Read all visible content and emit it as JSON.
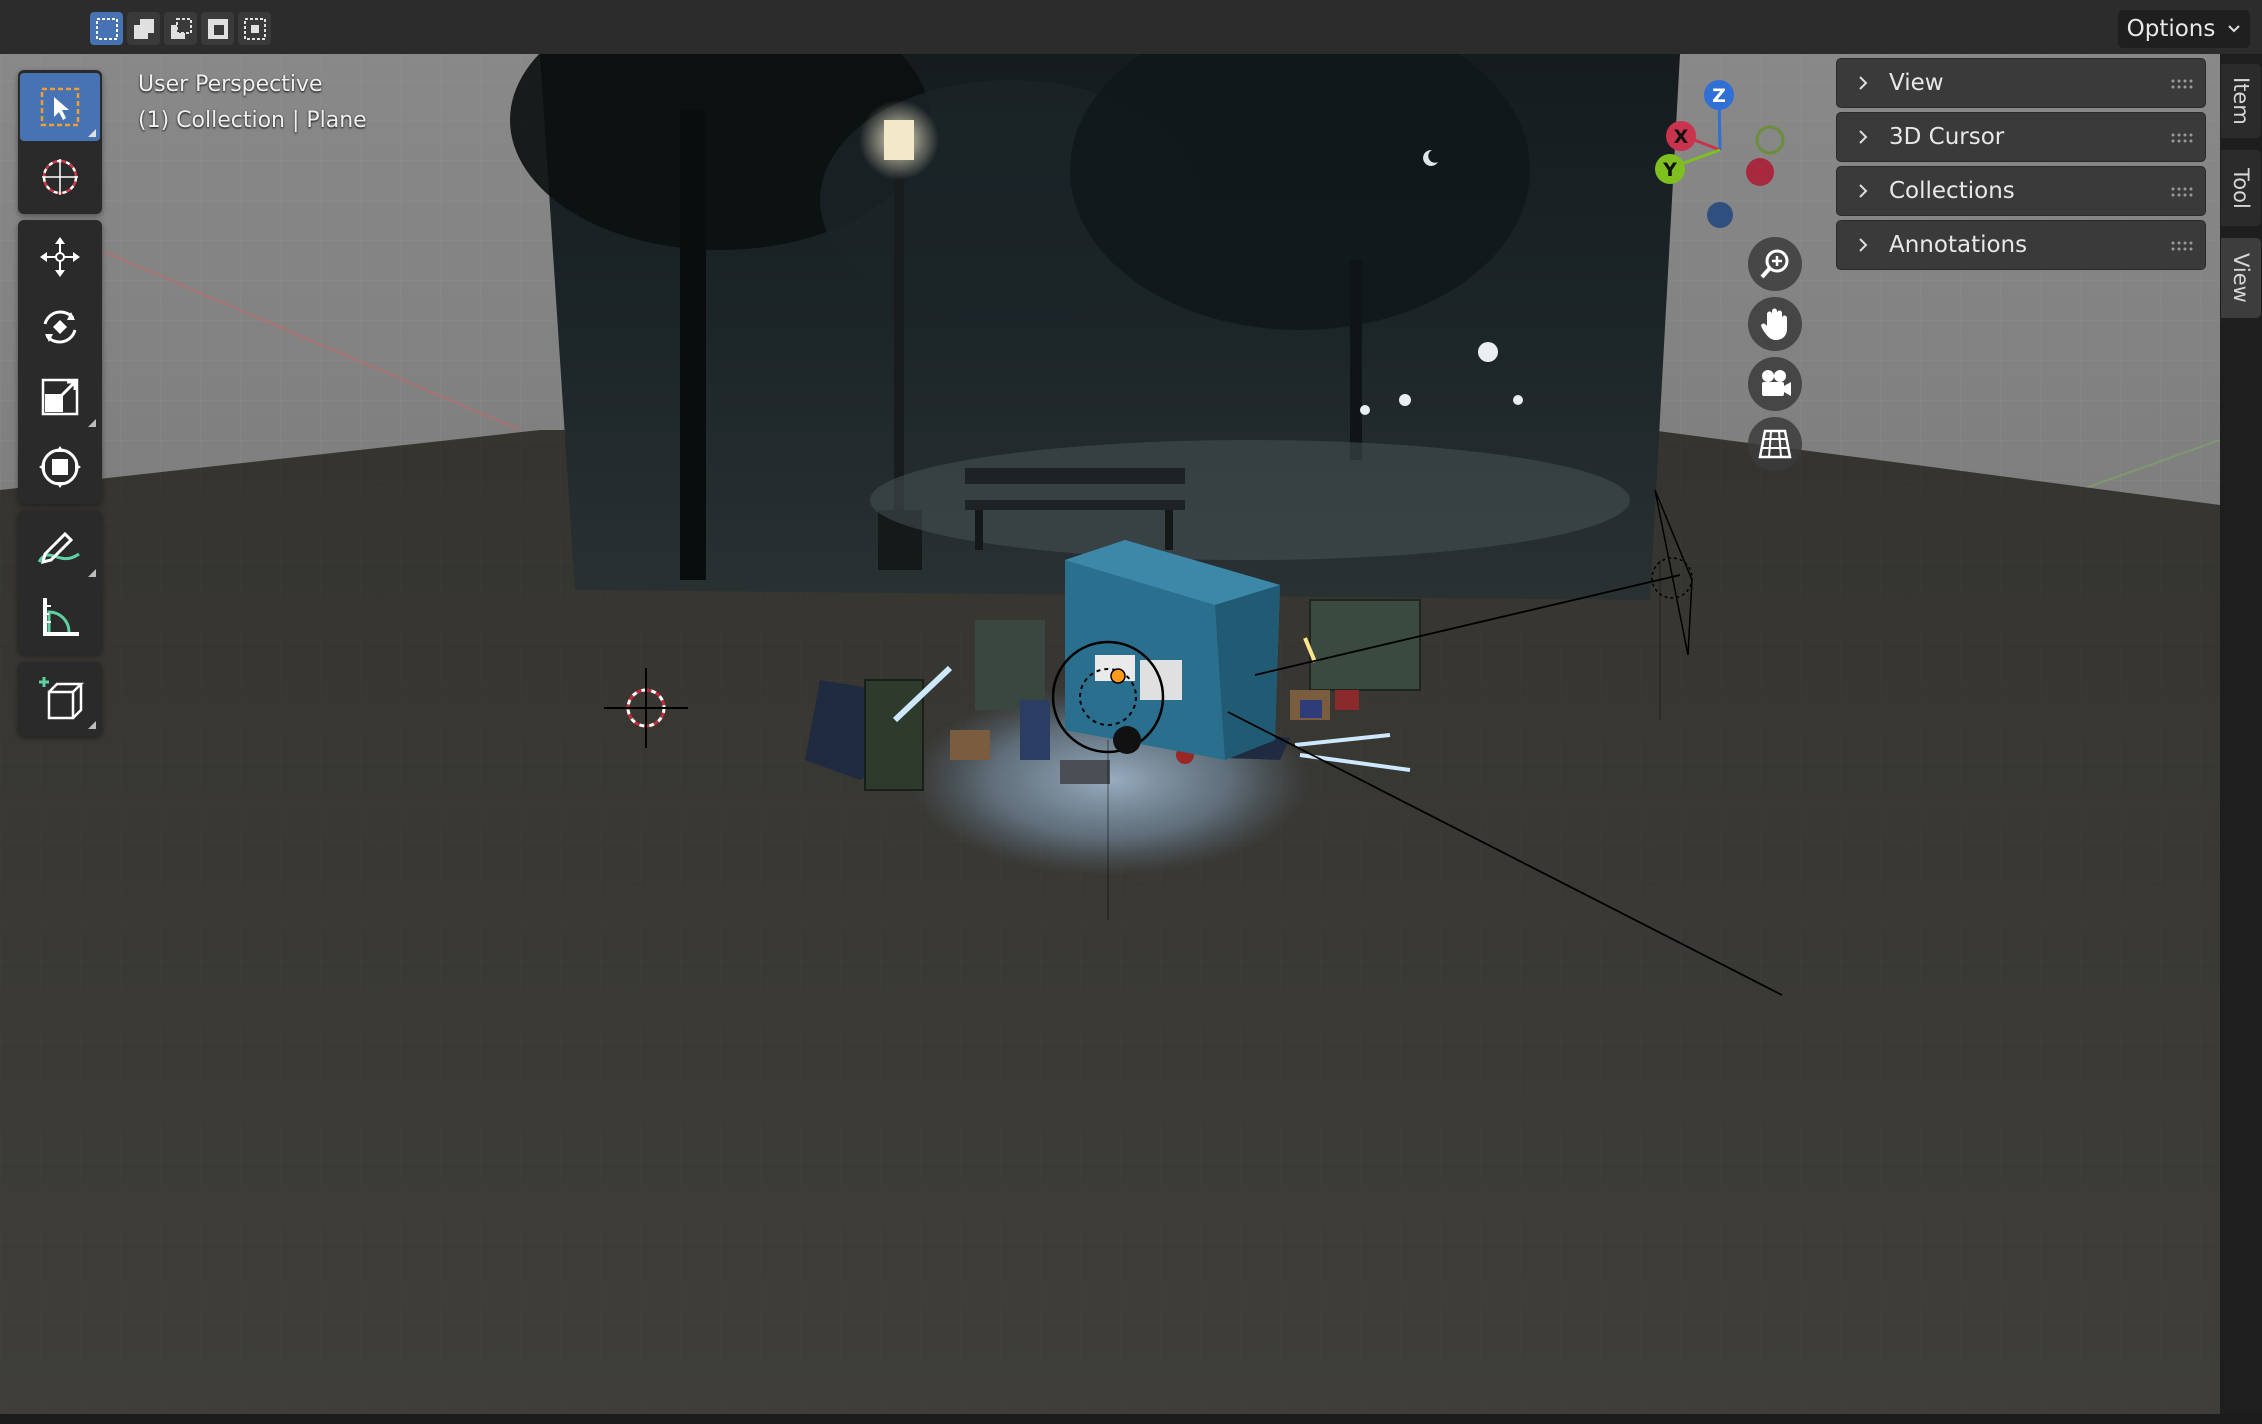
{
  "header": {
    "selection_modes": [
      {
        "name": "select-box-new",
        "active": true
      },
      {
        "name": "select-box-extend",
        "active": false
      },
      {
        "name": "select-box-subtract",
        "active": false
      },
      {
        "name": "select-box-invert",
        "active": false
      },
      {
        "name": "select-box-intersect",
        "active": false
      }
    ],
    "options_label": "Options"
  },
  "viewport": {
    "perspective_label": "User Perspective",
    "collection_label": "(1) Collection | Plane"
  },
  "toolbar": {
    "tools": [
      {
        "name": "select-box-tool",
        "icon": "cursor-box-icon",
        "active": true
      },
      {
        "name": "cursor-tool",
        "icon": "3d-cursor-icon",
        "active": false
      },
      {
        "name": "move-tool",
        "icon": "move-arrows-icon",
        "active": false
      },
      {
        "name": "rotate-tool",
        "icon": "rotate-icon",
        "active": false
      },
      {
        "name": "scale-tool",
        "icon": "scale-icon",
        "active": false
      },
      {
        "name": "transform-tool",
        "icon": "transform-icon",
        "active": false
      },
      {
        "name": "annotate-tool",
        "icon": "annotate-pencil-icon",
        "active": false
      },
      {
        "name": "measure-tool",
        "icon": "measure-ruler-icon",
        "active": false
      },
      {
        "name": "add-cube-tool",
        "icon": "add-cube-icon",
        "active": false
      }
    ]
  },
  "gizmo": {
    "axes": [
      {
        "label": "Z",
        "color": "#2f6fd6"
      },
      {
        "label": "X",
        "color": "#c9334b"
      },
      {
        "label": "Y",
        "color": "#7fbf1f"
      }
    ]
  },
  "nav_buttons": [
    "zoom-icon",
    "pan-hand-icon",
    "camera-icon",
    "ortho-grid-icon"
  ],
  "sidebar": {
    "panels": [
      {
        "label": "View"
      },
      {
        "label": "3D Cursor"
      },
      {
        "label": "Collections"
      },
      {
        "label": "Annotations"
      }
    ],
    "tabs": [
      {
        "label": "Item",
        "active": false
      },
      {
        "label": "Tool",
        "active": false
      },
      {
        "label": "View",
        "active": true
      }
    ]
  },
  "colors": {
    "accent": "#4772b3",
    "header_bg": "#2c2c2c",
    "panel_bg": "#3a3a3a",
    "ground": "#3b3b38",
    "dumpster": "#2b6f8e"
  }
}
